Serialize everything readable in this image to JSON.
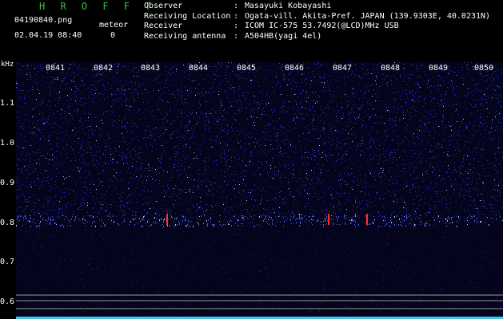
{
  "header": {
    "brand": "H R O F F T",
    "filename": "04190840.png",
    "datetime": "02.04.19 08:40",
    "meteor_label": "meteor",
    "meteor_count": "0",
    "info": [
      {
        "key": "Observer",
        "value": "Masayuki Kobayashi"
      },
      {
        "key": "Receiving Location",
        "value": "Ogata-vill. Akita-Pref. JAPAN (139.9303E, 40.0231N)"
      },
      {
        "key": "Receiver",
        "value": "ICOM IC-575 53.7492(@LCD)MHz USB"
      },
      {
        "key": "Receiving antenna",
        "value": "A504HB(yagi 4el)"
      }
    ]
  },
  "axis": {
    "unit": "kHz",
    "y_ticks": [
      "1.1",
      "1.0",
      "0.9",
      "0.8",
      "0.7",
      "0.6"
    ],
    "x_ticks": [
      "0841",
      "0842",
      "0843",
      "0844",
      "0845",
      "0846",
      "0847",
      "0848",
      "0849",
      "0850"
    ]
  },
  "colors": {
    "text": "#ffffff",
    "brand": "#39c23d",
    "background": "#000000",
    "noise_blue": "#2a2ad0",
    "signal_red": "#ff3030",
    "cyan_bar": "#40c8e8",
    "ref_line": "#9a9a9a"
  }
}
